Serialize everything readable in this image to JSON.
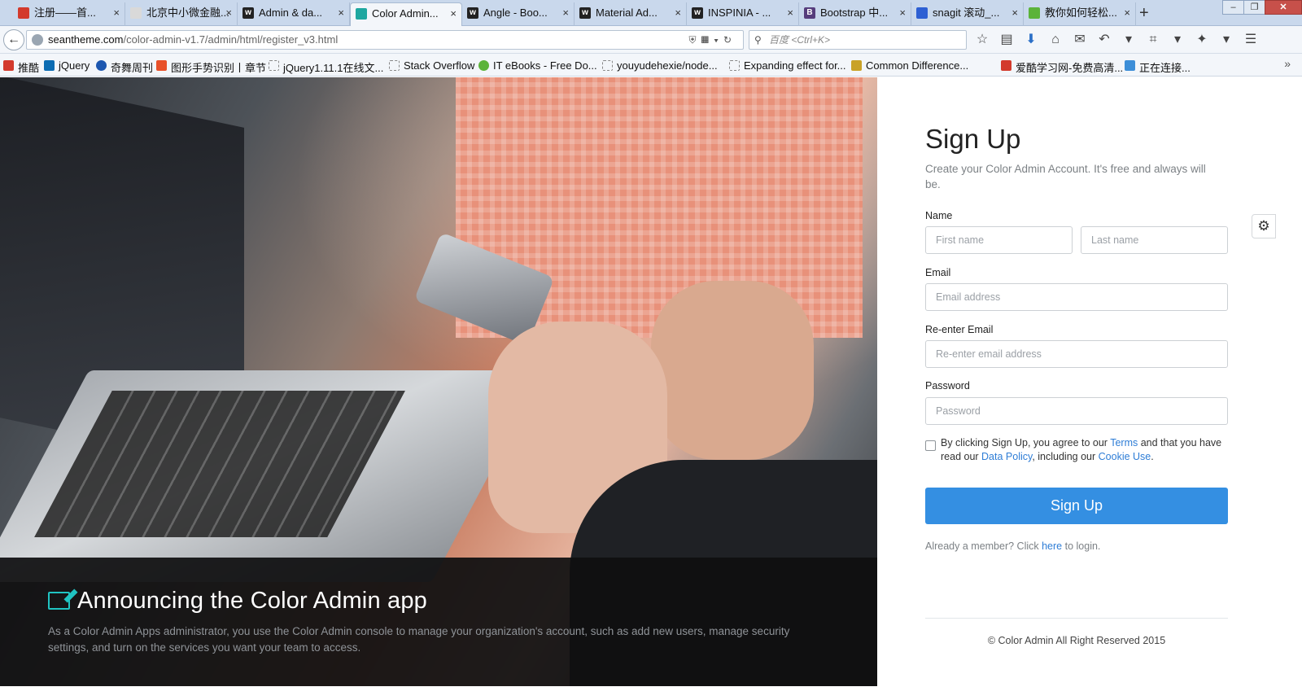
{
  "browser": {
    "tabs": [
      {
        "label": "注册——首...",
        "favicon_color": "#d33a2c"
      },
      {
        "label": "北京中小微金融...",
        "favicon_color": "#d9d9d9"
      },
      {
        "label": "Admin & da...",
        "favicon_color": "#222222"
      },
      {
        "label": "Color Admin...",
        "favicon_color": "#1fa7a0",
        "active": true
      },
      {
        "label": "Angle - Boo...",
        "favicon_color": "#222222"
      },
      {
        "label": "Material Ad...",
        "favicon_color": "#222222"
      },
      {
        "label": "INSPINIA - ...",
        "favicon_color": "#222222"
      },
      {
        "label": "Bootstrap 中...",
        "favicon_color": "#563d7c"
      },
      {
        "label": "snagit 滚动_...",
        "favicon_color": "#2d5fd3"
      },
      {
        "label": "教你如何轻松...",
        "favicon_color": "#5bb33a"
      }
    ],
    "tab_favicon_letters": [
      "",
      "",
      "w",
      "",
      "w",
      "w",
      "w",
      "B",
      "",
      ""
    ],
    "new_tab": "+",
    "url_host": "seantheme.com",
    "url_path": "/color-admin-v1.7/admin/html/register_v3.html",
    "search_placeholder": "百度 <Ctrl+K>",
    "bookmarks": [
      {
        "label": "推酷",
        "color": "#d33a2c"
      },
      {
        "label": "jQuery",
        "color": "#0b6cb3"
      },
      {
        "label": "奇舞周刊",
        "color": "#1d57b0"
      },
      {
        "label": "图形手势识别丨章节",
        "color": "#e8512a"
      },
      {
        "label": "jQuery1.11.1在线文...",
        "color": "#ffffff"
      },
      {
        "label": "Stack Overflow",
        "color": "#ffffff"
      },
      {
        "label": "IT eBooks - Free Do...",
        "color": "#5bb33a"
      },
      {
        "label": "youyudehexie/node...",
        "color": "#ffffff"
      },
      {
        "label": "Expanding effect for...",
        "color": "#ffffff"
      },
      {
        "label": "Common Difference...",
        "color": "#c9a227"
      },
      {
        "label": "爱酷学习网-免费高清...",
        "color": "#d33a2c"
      },
      {
        "label": "正在连接...",
        "color": "#3c8ed8"
      }
    ]
  },
  "hero": {
    "title": "Announcing the Color Admin app",
    "text": "As a Color Admin Apps administrator, you use the Color Admin console to manage your organization's account, such as add new users, manage security settings, and turn on the services you want your team to access.",
    "accent_color": "#20c4c2"
  },
  "form": {
    "title": "Sign Up",
    "subtitle": "Create your Color Admin Account. It's free and always will be.",
    "name_label": "Name",
    "first_name_placeholder": "First name",
    "last_name_placeholder": "Last name",
    "email_label": "Email",
    "email_placeholder": "Email address",
    "reemail_label": "Re-enter Email",
    "reemail_placeholder": "Re-enter email address",
    "password_label": "Password",
    "password_placeholder": "Password",
    "terms_prefix": "By clicking Sign Up, you agree to our ",
    "terms_link": "Terms",
    "terms_mid1": " and that you have read our ",
    "data_policy_link": "Data Policy",
    "terms_mid2": ", including our ",
    "cookie_link": "Cookie Use",
    "terms_suffix": ".",
    "signup_button": "Sign Up",
    "already_prefix": "Already a member? Click ",
    "here_link": "here",
    "already_suffix": " to login.",
    "copyright": "© Color Admin All Right Reserved 2015",
    "primary_color": "#348fe2"
  }
}
